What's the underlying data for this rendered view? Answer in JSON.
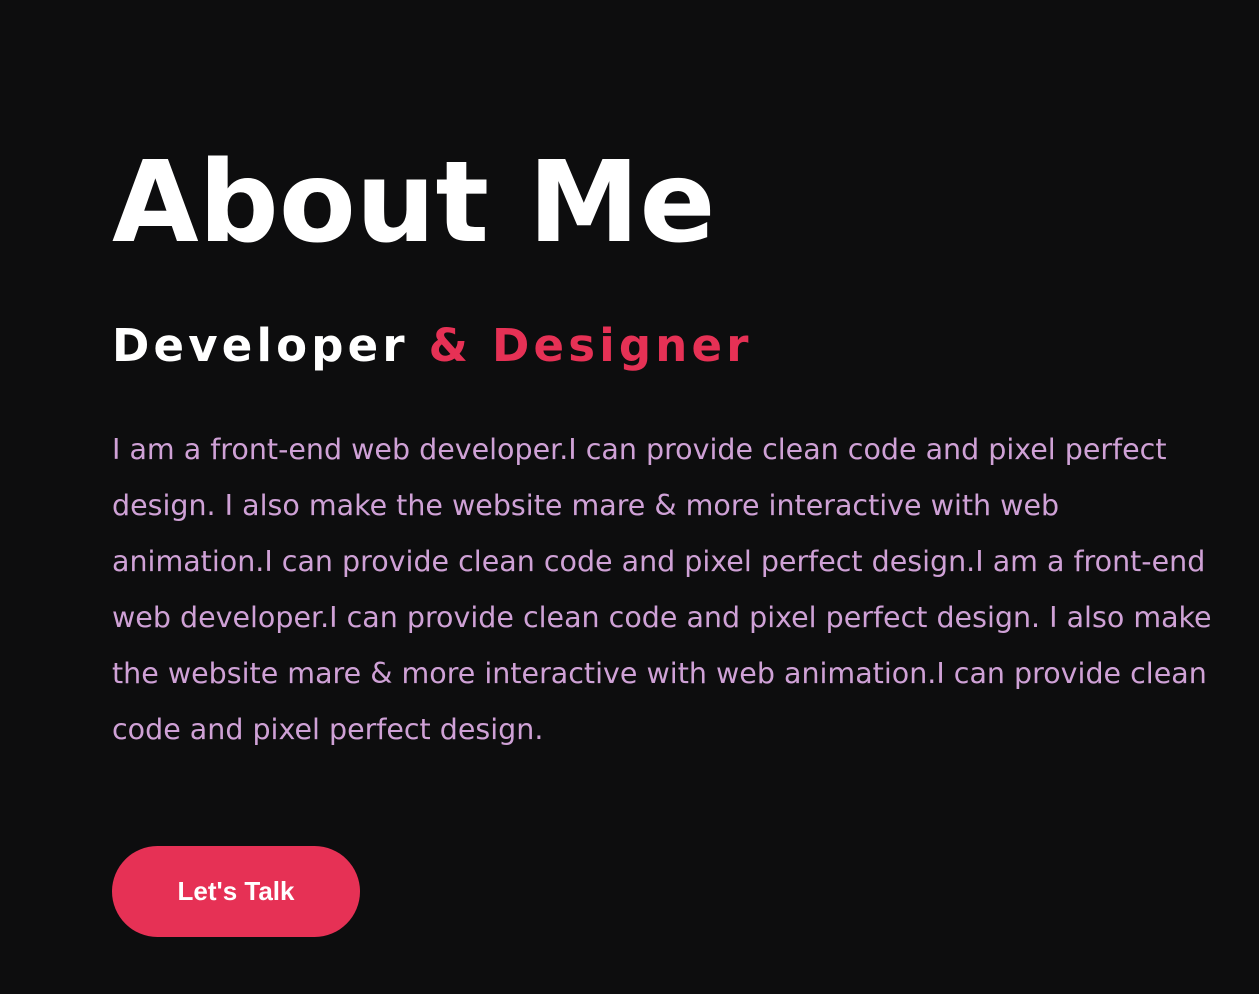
{
  "about": {
    "title": "About Me",
    "subtitle_plain": "Developer",
    "subtitle_accent": "& Designer",
    "bio": "I am a front-end web developer.I can provide clean code and pixel perfect design. I also make the website mare & more interactive with web animation.I can provide clean code and pixel perfect design.I am a front-end web developer.I can provide clean code and pixel perfect design. I also make the website mare & more interactive with web animation.I can provide clean code and pixel perfect design.",
    "cta_label": "Let's Talk"
  },
  "colors": {
    "background": "#0d0d0e",
    "heading": "#ffffff",
    "accent": "#e63155",
    "body_text": "#cfa1d6"
  }
}
